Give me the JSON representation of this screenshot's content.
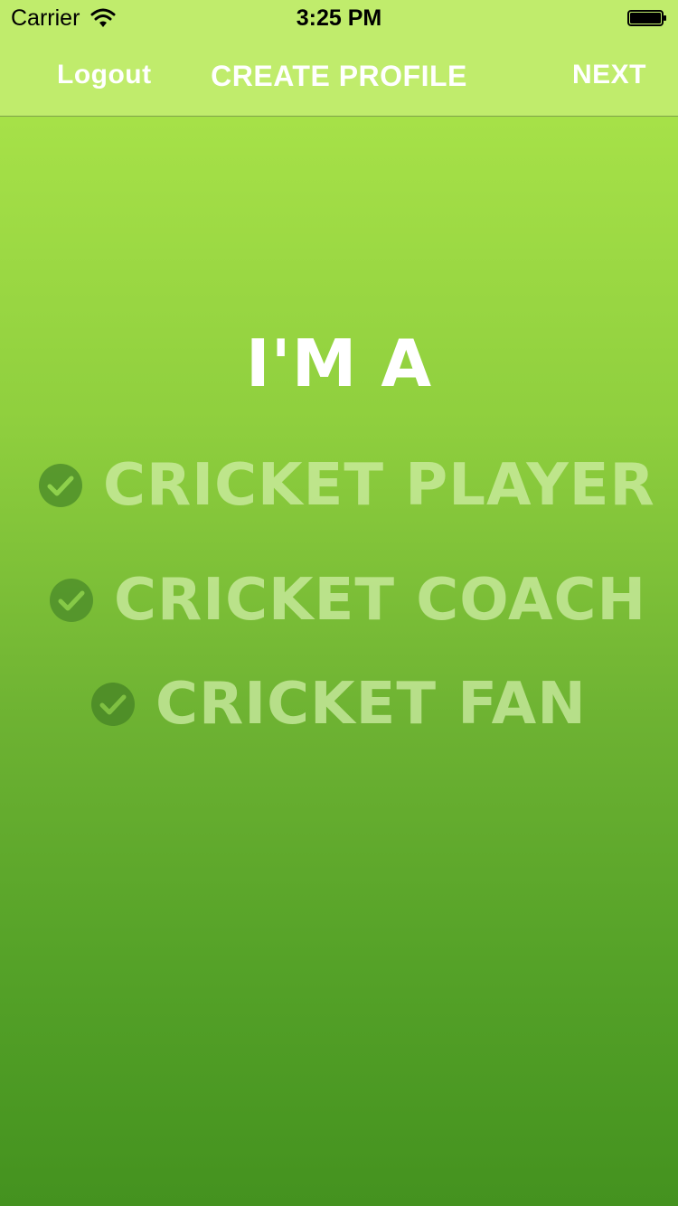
{
  "status_bar": {
    "carrier": "Carrier",
    "time": "3:25 PM",
    "icons": [
      "wifi-icon",
      "battery-icon"
    ]
  },
  "nav": {
    "left_label": "Logout",
    "title": "CREATE PROFILE",
    "right_label": "NEXT"
  },
  "main": {
    "heading": "I'M A",
    "options": [
      {
        "label": "CRICKET PLAYER",
        "icon": "check-circle-icon"
      },
      {
        "label": "CRICKET COACH",
        "icon": "check-circle-icon"
      },
      {
        "label": "CRICKET FAN",
        "icon": "check-circle-icon"
      }
    ]
  },
  "colors": {
    "nav_background": "#c0ec6c",
    "gradient_top": "#a9e44a",
    "gradient_bottom": "#44921f",
    "check_fill": "#4f8f2a",
    "option_text": "#d2f0aa"
  }
}
